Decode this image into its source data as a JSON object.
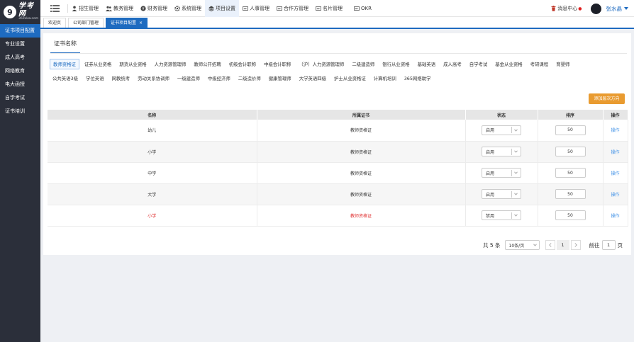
{
  "logo": {
    "mark": "9",
    "title": "学考网",
    "subtitle": "360xkw.com"
  },
  "sidebar": {
    "items": [
      {
        "label": "证书项目配置"
      },
      {
        "label": "专业设置"
      },
      {
        "label": "成人高考"
      },
      {
        "label": "网络教育"
      },
      {
        "label": "电大函授"
      },
      {
        "label": "自学考试"
      },
      {
        "label": "证书培训"
      }
    ]
  },
  "topnav": {
    "items": [
      {
        "label": "招生管理",
        "icon": "user-icon"
      },
      {
        "label": "教务管理",
        "icon": "users-icon"
      },
      {
        "label": "财务管理",
        "icon": "money-icon"
      },
      {
        "label": "系统管理",
        "icon": "gear-icon"
      },
      {
        "label": "项目设置",
        "icon": "layers-icon"
      },
      {
        "label": "人事管理",
        "icon": "card-icon"
      },
      {
        "label": "合作方管理",
        "icon": "card-icon"
      },
      {
        "label": "名片管理",
        "icon": "card-icon"
      },
      {
        "label": "OKR",
        "icon": "card-icon"
      }
    ],
    "message_label": "消息中心",
    "user_name": "张水晶"
  },
  "tabs": [
    {
      "label": "欢迎页"
    },
    {
      "label": "公司部门管理"
    },
    {
      "label": "证书项目配置",
      "close": "×"
    }
  ],
  "card": {
    "title": "证书名称",
    "categories_row1": [
      "教师资格证",
      "证券从业资格",
      "期货从业资格",
      "人力资源管理师",
      "教师公开招聘",
      "初级会计职称",
      "中级会计职称",
      "（沪）人力资源管理师",
      "二级建造师",
      "银行从业资格",
      "基础英语",
      "成人高考",
      "自学考试",
      "基金从业资格",
      "考研课程",
      "育婴师"
    ],
    "categories_row2": [
      "公共英语3级",
      "学位英语",
      "网教统考",
      "劳动关系协调师",
      "一级建造师",
      "中级经济师",
      "二级造价师",
      "健康管理师",
      "大学英语四级",
      "护士从业资格证",
      "计算机培训",
      "365网络助学"
    ],
    "add_button": "添加层次方向"
  },
  "table": {
    "headers": [
      "名称",
      "所属证书",
      "状态",
      "排序",
      "操作"
    ],
    "rows": [
      {
        "name": "幼儿",
        "cert": "教师资格证",
        "status": "启用",
        "sort": "50",
        "action": "操作"
      },
      {
        "name": "小学",
        "cert": "教师资格证",
        "status": "启用",
        "sort": "50",
        "action": "操作"
      },
      {
        "name": "中学",
        "cert": "教师资格证",
        "status": "启用",
        "sort": "50",
        "action": "操作"
      },
      {
        "name": "大学",
        "cert": "教师资格证",
        "status": "启用",
        "sort": "50",
        "action": "操作"
      },
      {
        "name": "小学",
        "cert": "教师资格证",
        "status": "禁用",
        "sort": "50",
        "action": "操作"
      }
    ]
  },
  "pagination": {
    "total": "共 5 条",
    "page_size": "10条/页",
    "current_page": "1",
    "goto_prefix": "前往",
    "goto_value": "1",
    "goto_suffix": "页"
  },
  "colors": {
    "accent": "#1e6bc0",
    "sidebar_bg": "#2b2f3a",
    "add_button": "#e99b30",
    "disabled_text": "#e03030",
    "link": "#3a8ee6"
  }
}
